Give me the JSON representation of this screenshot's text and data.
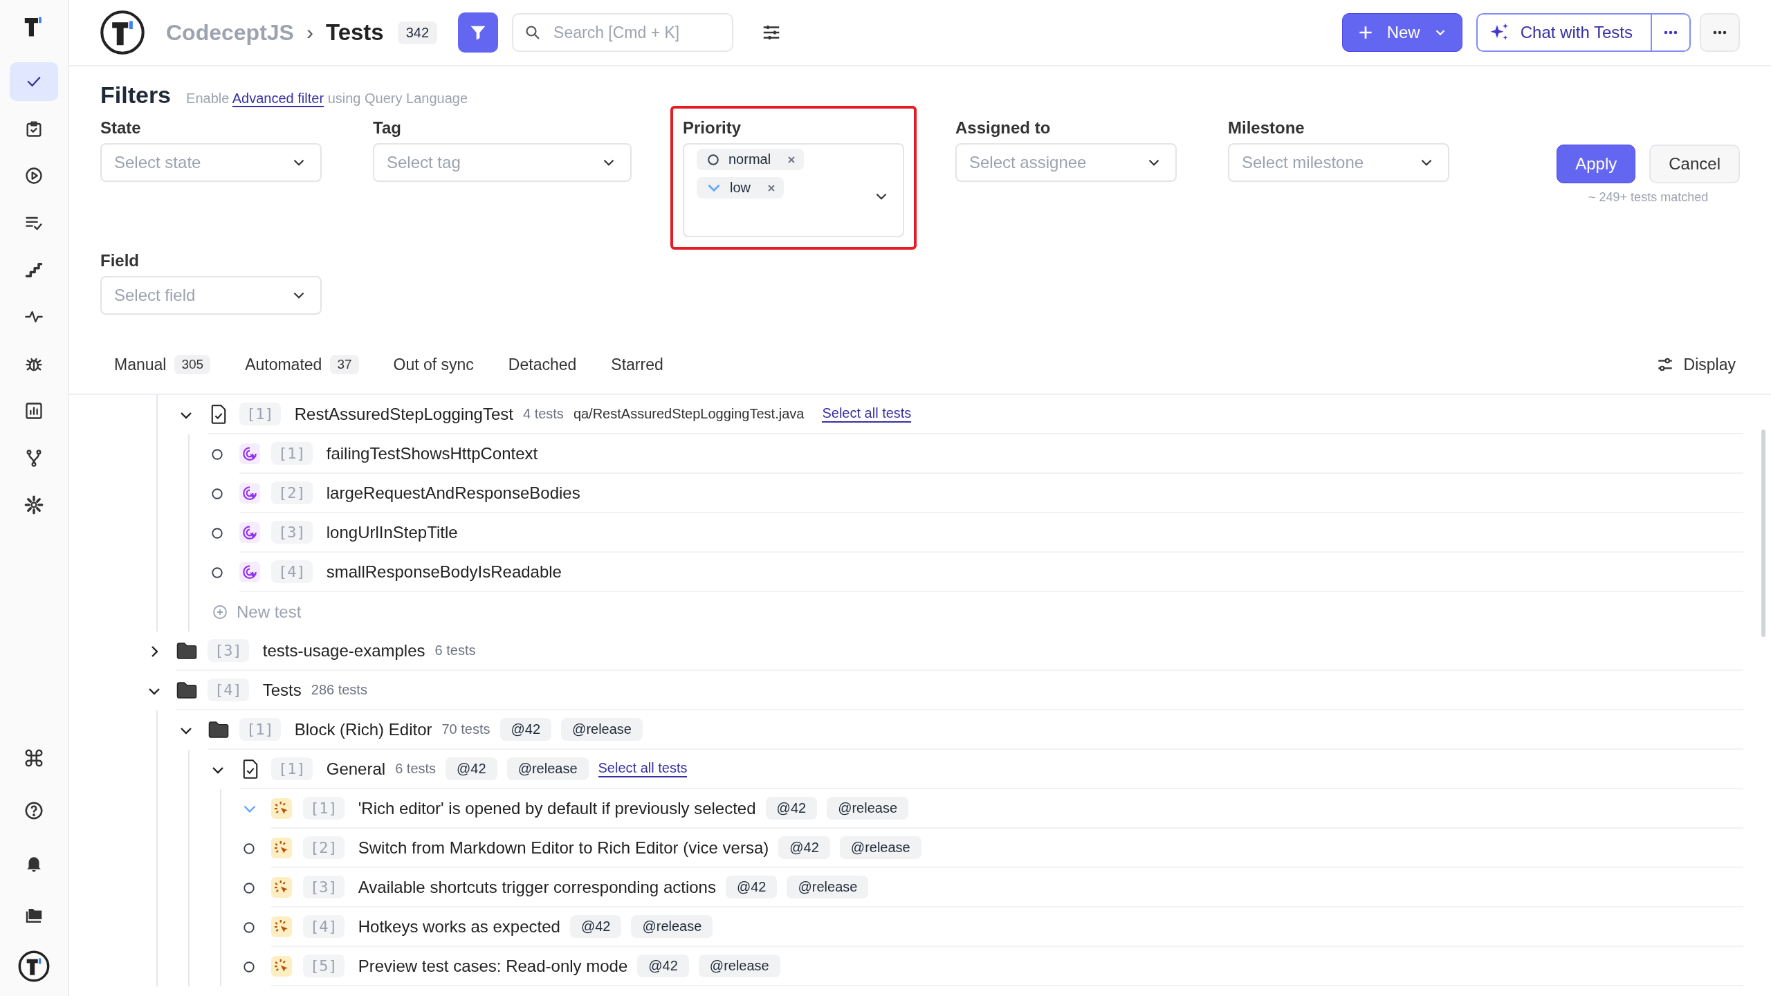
{
  "sidebar": {
    "items": [
      {
        "selected": true
      },
      {
        "selected": false
      },
      {
        "selected": false
      },
      {
        "selected": false
      },
      {
        "selected": false
      },
      {
        "selected": false
      },
      {
        "selected": false
      },
      {
        "selected": false
      },
      {
        "selected": false
      },
      {
        "selected": false
      }
    ]
  },
  "header": {
    "project": "CodeceptJS",
    "separator": "›",
    "title": "Tests",
    "count": "342",
    "filter_active": true,
    "search": {
      "placeholder": "Search [Cmd + K]"
    },
    "new_button": "New",
    "chat_button": "Chat with Tests"
  },
  "filters": {
    "title": "Filters",
    "hint_before": "Enable",
    "hint_link": "Advanced filter",
    "hint_after": "using Query Language",
    "fields": [
      {
        "label": "State",
        "placeholder": "Select state",
        "highlighted": false
      },
      {
        "label": "Tag",
        "placeholder": "Select tag",
        "highlighted": false
      },
      {
        "label": "Priority",
        "highlighted": true,
        "chips": [
          {
            "label": "normal",
            "low_priority": false
          },
          {
            "label": "low",
            "low_priority": true
          }
        ]
      },
      {
        "label": "Assigned to",
        "placeholder": "Select assignee",
        "highlighted": false
      },
      {
        "label": "Milestone",
        "placeholder": "Select milestone",
        "highlighted": false
      },
      {
        "label": "Field",
        "placeholder": "Select field",
        "highlighted": false
      }
    ],
    "apply": "Apply",
    "cancel": "Cancel",
    "matched": "~ 249+ tests matched"
  },
  "tabs": [
    {
      "label": "Manual",
      "count": "305",
      "selected": false
    },
    {
      "label": "Automated",
      "count": "37",
      "selected": false
    },
    {
      "label": "Out of sync",
      "selected": false
    },
    {
      "label": "Detached",
      "selected": false
    },
    {
      "label": "Starred",
      "selected": false
    }
  ],
  "display_button": "Display",
  "tree": [
    {
      "kind": "continued",
      "children": [
        {
          "kind": "file",
          "expanded": true,
          "index": "[1]",
          "title": "RestAssuredStepLoggingTest",
          "count": "4 tests",
          "path": "qa/RestAssuredStepLoggingTest.java",
          "select_link": "Select all tests",
          "new_test": "New test",
          "children": [
            {
              "kind": "test",
              "automated": true,
              "low_priority": false,
              "index": "[1]",
              "title": "failingTestShowsHttpContext"
            },
            {
              "kind": "test",
              "automated": true,
              "low_priority": false,
              "index": "[2]",
              "title": "largeRequestAndResponseBodies"
            },
            {
              "kind": "test",
              "automated": true,
              "low_priority": false,
              "index": "[3]",
              "title": "longUrlInStepTitle"
            },
            {
              "kind": "test",
              "automated": true,
              "low_priority": false,
              "index": "[4]",
              "title": "smallResponseBodyIsReadable"
            }
          ]
        }
      ]
    },
    {
      "kind": "folder",
      "expanded": false,
      "index": "[3]",
      "title": "tests-usage-examples",
      "count": "6 tests"
    },
    {
      "kind": "folder",
      "expanded": true,
      "index": "[4]",
      "title": "Tests",
      "count": "286 tests",
      "children": [
        {
          "kind": "folder",
          "expanded": true,
          "index": "[1]",
          "title": "Block (Rich) Editor",
          "count": "70 tests",
          "tags": [
            "@42",
            "@release"
          ],
          "children": [
            {
              "kind": "file",
              "expanded": true,
              "index": "[1]",
              "title": "General",
              "count": "6 tests",
              "tags": [
                "@42",
                "@release"
              ],
              "select_link": "Select all tests",
              "children": [
                {
                  "kind": "test",
                  "automated": false,
                  "low_priority": true,
                  "index": "[1]",
                  "title": "'Rich editor' is opened by default if previously selected",
                  "tags": [
                    "@42",
                    "@release"
                  ]
                },
                {
                  "kind": "test",
                  "automated": false,
                  "low_priority": false,
                  "index": "[2]",
                  "title": "Switch from Markdown Editor to Rich Editor (vice versa)",
                  "tags": [
                    "@42",
                    "@release"
                  ]
                },
                {
                  "kind": "test",
                  "automated": false,
                  "low_priority": false,
                  "index": "[3]",
                  "title": "Available shortcuts trigger corresponding actions",
                  "tags": [
                    "@42",
                    "@release"
                  ]
                },
                {
                  "kind": "test",
                  "automated": false,
                  "low_priority": false,
                  "index": "[4]",
                  "title": "Hotkeys works as expected",
                  "tags": [
                    "@42",
                    "@release"
                  ]
                },
                {
                  "kind": "test",
                  "automated": false,
                  "low_priority": false,
                  "index": "[5]",
                  "title": "Preview test cases: Read-only mode",
                  "tags": [
                    "@42",
                    "@release"
                  ]
                }
              ]
            }
          ]
        }
      ]
    }
  ]
}
